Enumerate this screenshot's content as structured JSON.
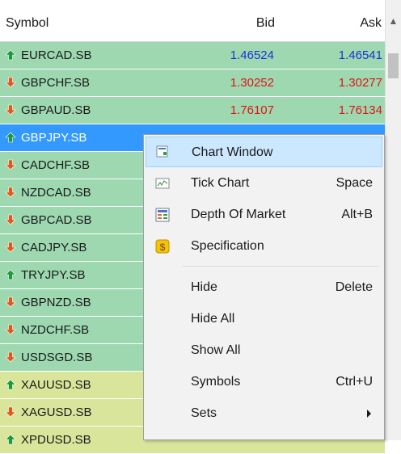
{
  "header": {
    "symbol": "Symbol",
    "bid": "Bid",
    "ask": "Ask"
  },
  "colors": {
    "forex_row": "#9dd8b1",
    "metal_row": "#d9e59a",
    "selected_row": "#3399ff",
    "bid_blue": "#1a33d6",
    "bid_red": "#e01515",
    "up_arrow": "#1f9a3a",
    "down_arrow": "#e0581a",
    "menu_highlight": "#cce8ff"
  },
  "rows": [
    {
      "symbol": "EURCAD.SB",
      "dir": "up",
      "bid": "1.46524",
      "ask": "1.46541",
      "tone": "blue",
      "group": "forex"
    },
    {
      "symbol": "GBPCHF.SB",
      "dir": "down",
      "bid": "1.30252",
      "ask": "1.30277",
      "tone": "red",
      "group": "forex"
    },
    {
      "symbol": "GBPAUD.SB",
      "dir": "down",
      "bid": "1.76107",
      "ask": "1.76134",
      "tone": "red",
      "group": "forex"
    },
    {
      "symbol": "GBPJPY.SB",
      "dir": "up",
      "bid": "",
      "ask": "",
      "tone": "white",
      "group": "selected"
    },
    {
      "symbol": "CADCHF.SB",
      "dir": "down",
      "bid": "",
      "ask": "",
      "tone": "",
      "group": "forex"
    },
    {
      "symbol": "NZDCAD.SB",
      "dir": "down",
      "bid": "",
      "ask": "",
      "tone": "",
      "group": "forex"
    },
    {
      "symbol": "GBPCAD.SB",
      "dir": "down",
      "bid": "",
      "ask": "",
      "tone": "",
      "group": "forex"
    },
    {
      "symbol": "CADJPY.SB",
      "dir": "down",
      "bid": "",
      "ask": "",
      "tone": "",
      "group": "forex"
    },
    {
      "symbol": "TRYJPY.SB",
      "dir": "up",
      "bid": "",
      "ask": "",
      "tone": "",
      "group": "forex"
    },
    {
      "symbol": "GBPNZD.SB",
      "dir": "down",
      "bid": "",
      "ask": "",
      "tone": "",
      "group": "forex"
    },
    {
      "symbol": "NZDCHF.SB",
      "dir": "down",
      "bid": "",
      "ask": "",
      "tone": "",
      "group": "forex"
    },
    {
      "symbol": "USDSGD.SB",
      "dir": "down",
      "bid": "",
      "ask": "",
      "tone": "",
      "group": "forex"
    },
    {
      "symbol": "XAUUSD.SB",
      "dir": "up",
      "bid": "",
      "ask": "",
      "tone": "",
      "group": "metal"
    },
    {
      "symbol": "XAGUSD.SB",
      "dir": "down",
      "bid": "",
      "ask": "",
      "tone": "",
      "group": "metal"
    },
    {
      "symbol": "XPDUSD.SB",
      "dir": "up",
      "bid": "",
      "ask": "",
      "tone": "",
      "group": "metal"
    }
  ],
  "menu": {
    "items": [
      {
        "label": "Chart Window",
        "shortcut": "",
        "icon": "chart-window-icon",
        "highlighted": true
      },
      {
        "label": "Tick Chart",
        "shortcut": "Space",
        "icon": "tick-chart-icon"
      },
      {
        "label": "Depth Of Market",
        "shortcut": "Alt+B",
        "icon": "depth-of-market-icon"
      },
      {
        "label": "Specification",
        "shortcut": "",
        "icon": "specification-icon"
      },
      {
        "label": "Hide",
        "shortcut": "Delete"
      },
      {
        "label": "Hide All",
        "shortcut": ""
      },
      {
        "label": "Show All",
        "shortcut": ""
      },
      {
        "label": "Symbols",
        "shortcut": "Ctrl+U"
      },
      {
        "label": "Sets",
        "shortcut": "",
        "submenu": true
      }
    ]
  }
}
